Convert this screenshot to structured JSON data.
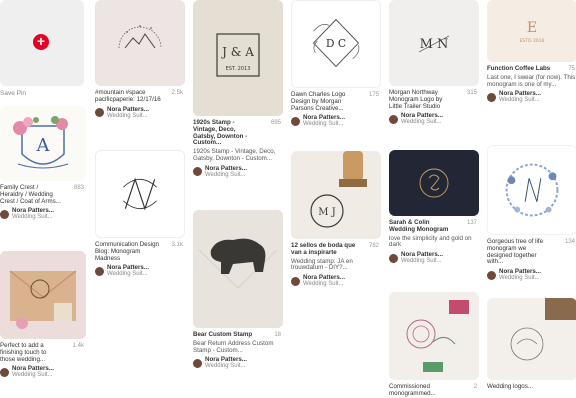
{
  "save_pin": {
    "label": "Save Pin",
    "plus": "+"
  },
  "pins": {
    "c1p2": {
      "title": "Family Crest / Heraldry / Wedding Crest / Coat of Arms...",
      "saves": "883",
      "author": "Nora Patters...",
      "board": "Wedding Suit..."
    },
    "c1p3": {
      "title": "Perfect to add a finishing touch to those wedding...",
      "saves": "1.4k",
      "author": "Nora Patters...",
      "board": "Wedding Suit..."
    },
    "c2p1": {
      "title": "#mountain #space pacificpaperie: 12/17/16",
      "saves": "2.5k",
      "author": "Nora Patters...",
      "board": "Wedding Suit..."
    },
    "c2p2": {
      "title": "Communication Design Blog: Monogram Madness",
      "saves": "3.1k",
      "author": "Nora Patters...",
      "board": "Wedding Suit..."
    },
    "c3p1": {
      "title": "1920s Stamp - Vintage, Deco, Gatsby, Downton - Custom...",
      "saves": "695",
      "desc": "1920s Stamp - Vintage, Deco, Gatsby, Downton - Custom...",
      "author": "Nora Patters...",
      "board": "Wedding Suit..."
    },
    "c3p2": {
      "title": "Bear Custom Stamp",
      "saves": "18",
      "desc": "Bear Return Address Custom Stamp - Custom...",
      "author": "Nora Patters...",
      "board": "Wedding Suit..."
    },
    "c4p1": {
      "title": "Dawn Charles Logo Design by Morgan Parsons Creative...",
      "saves": "175",
      "author": "Nora Patters...",
      "board": "Wedding Suit..."
    },
    "c4p2": {
      "title": "12 sellos de boda que van a inspirarte",
      "saves": "782",
      "desc": "Wedding stamp: JA en trouwdatum - DIY?...",
      "author": "Nora Patters...",
      "board": "Wedding Suit..."
    },
    "c5p1": {
      "title": "Morgan Northway Monogram Logo by Little Trailer Studio",
      "saves": "315",
      "author": "Nora Patters...",
      "board": "Wedding Suit..."
    },
    "c5p2": {
      "title": "Sarah & Colin Wedding Monogram",
      "saves": "137",
      "desc": "love the simplicity and gold on dark",
      "author": "Nora Patters...",
      "board": "Wedding Suit..."
    },
    "c5p3": {
      "title": "Commissioned monogrammed...",
      "saves": "2"
    },
    "c6p1": {
      "title": "Function Coffee Labs",
      "saves": "75",
      "desc": "Last one, I swear (for now). This monogram is one of my...",
      "author": "Nora Patters...",
      "board": "Wedding Suit..."
    },
    "c6p2": {
      "title": "Gorgeous tree of life monogram we designed together with...",
      "saves": "134",
      "author": "Nora Patters...",
      "board": "Wedding Suit..."
    },
    "c6p3": {
      "title": "Wedding logos...",
      "saves": ""
    }
  },
  "art": {
    "c3p1_letters": "J & A",
    "c3p1_est": "EST. 2013",
    "c4p1_letters": "D C",
    "c5p1_letters": "M N",
    "c6p1_top": "E",
    "c6p1_est": "ESTD 2016",
    "c4p2_letters": "M J"
  },
  "colors": {
    "accent": "#e60023"
  }
}
